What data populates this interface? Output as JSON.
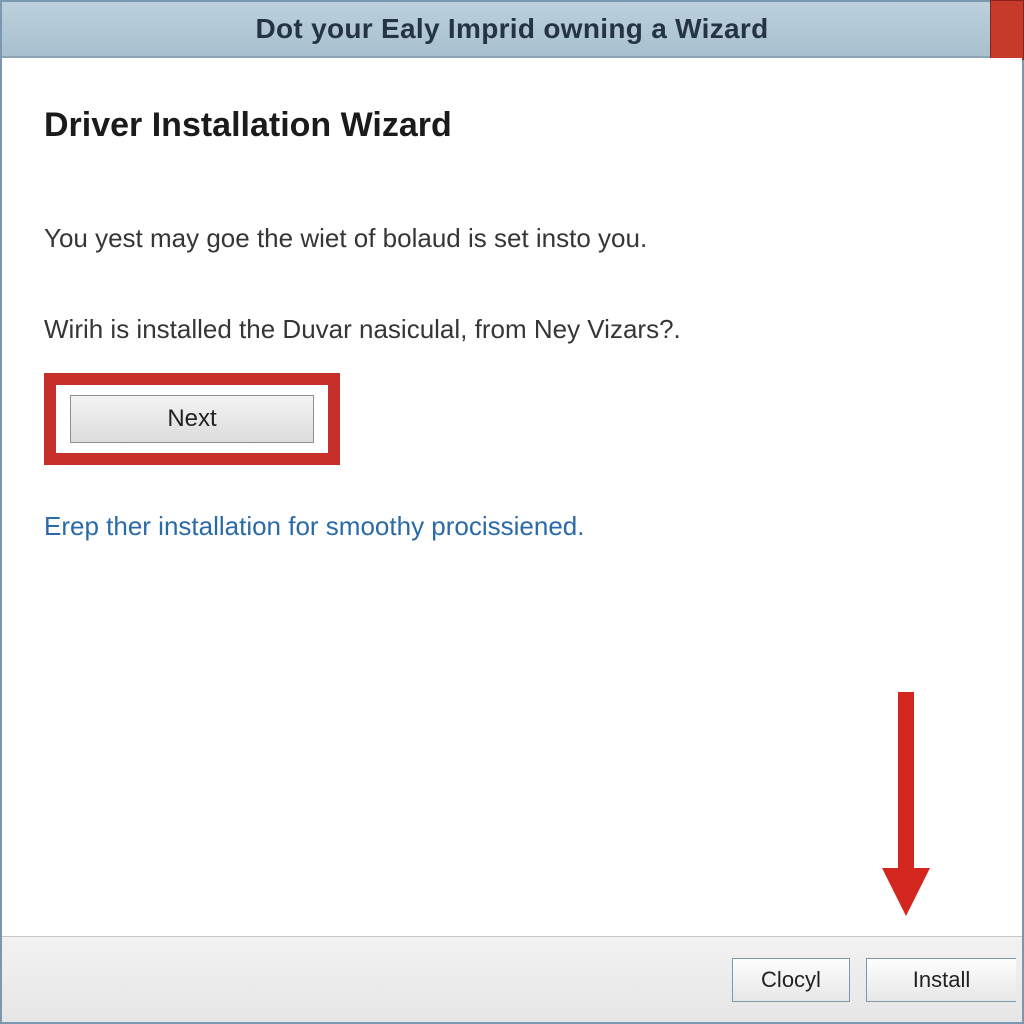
{
  "titlebar": {
    "title": "Dot your Ealy Imprid owning a Wizard"
  },
  "content": {
    "heading": "Driver Installation Wizard",
    "para1": "You yest may goe the wiet of bolaud is set insto you.",
    "para2": "Wirih is installed the Duvar nasiculal, from Ney Vizars?.",
    "next_label": "Next",
    "link": "Erep ther installation for smoothy procissiened."
  },
  "footer": {
    "clocyl_label": "Clocyl",
    "install_label": "Install"
  },
  "annotations": {
    "highlight_color": "#c62f2a",
    "arrow_color": "#d2261f"
  }
}
